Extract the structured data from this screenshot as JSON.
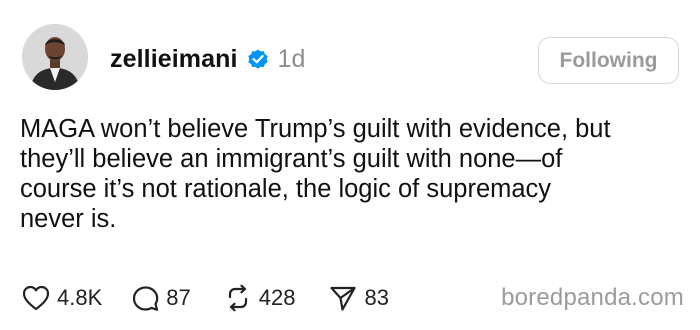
{
  "post": {
    "username": "zellieimani",
    "time_ago": "1d",
    "follow_label": "Following",
    "text_lines": [
      "MAGA won’t believe Trump’s guilt with evidence, but",
      "they’ll believe an immigrant’s guilt with none—of",
      "course it’s not rationale, the logic of supremacy",
      "never is."
    ],
    "actions": {
      "likes": "4.8K",
      "replies": "87",
      "reposts": "428",
      "shares": "83"
    },
    "icons": {
      "like": "heart-icon",
      "reply": "speech-bubble-icon",
      "repost": "repost-arrows-icon",
      "share": "paper-plane-icon",
      "verified": "verified-badge-icon"
    }
  },
  "watermark": "boredpanda.com",
  "colors": {
    "text": "#111111",
    "muted": "#8e8e8e",
    "verified_blue": "#0095f6",
    "button_border": "#d7d7d7"
  }
}
